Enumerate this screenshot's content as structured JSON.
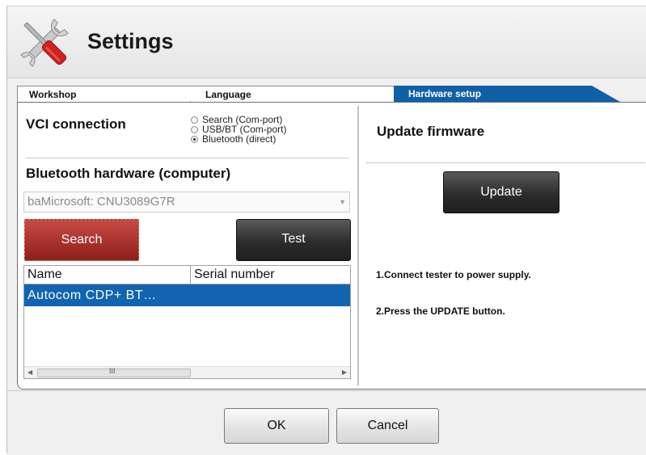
{
  "header": {
    "title": "Settings",
    "icon": "tools-icon"
  },
  "tabs": [
    {
      "label": "Workshop",
      "active": false
    },
    {
      "label": "Language",
      "active": false
    },
    {
      "label": "Hardware setup",
      "active": true
    }
  ],
  "colors": {
    "accent": "#1064b0",
    "search_button": "#b03a35",
    "dark_button": "#2c2c2c"
  },
  "left": {
    "vci_heading": "VCI connection",
    "radio_options": [
      {
        "label": "Search (Com-port)",
        "checked": false
      },
      {
        "label": "USB/BT (Com-port)",
        "checked": false
      },
      {
        "label": "Bluetooth (direct)",
        "checked": true
      }
    ],
    "bt_heading": "Bluetooth hardware (computer)",
    "bt_select_value": "baMicrosoft: CNU3089G7R",
    "search_label": "Search",
    "test_label": "Test",
    "list": {
      "columns": [
        "Name",
        "Serial number"
      ],
      "rows": [
        {
          "name": "Autocom CDP+ BT…",
          "serial": "",
          "selected": true
        }
      ],
      "scroll_grip": "III"
    }
  },
  "right": {
    "heading": "Update firmware",
    "update_label": "Update",
    "instructions": [
      "1.Connect tester to power supply.",
      "2.Press the UPDATE button."
    ]
  },
  "footer": {
    "ok_label": "OK",
    "cancel_label": "Cancel"
  }
}
